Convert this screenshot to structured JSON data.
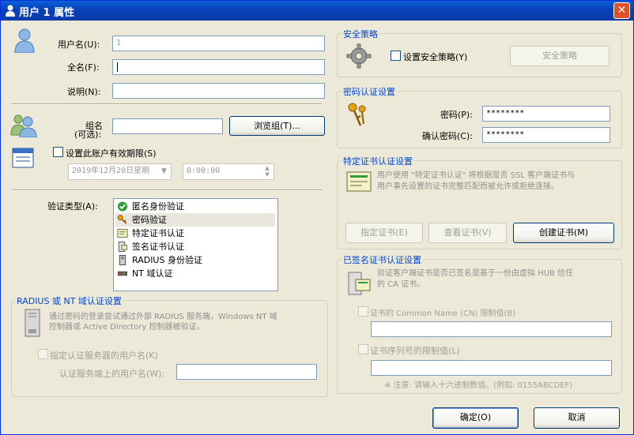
{
  "window": {
    "title": "用户 1 属性",
    "close_label": "✕"
  },
  "user": {
    "username_label": "用户名(U):",
    "username_value": "1",
    "fullname_label": "全名(F):",
    "fullname_value": "",
    "note_label": "说明(N):",
    "note_value": "",
    "group_label": "组名",
    "group_label_sub": "(可选):",
    "group_value": "",
    "browse_group_button": "浏览组(T)...",
    "expire_checkbox_label": "设置此账户有效期限(S)",
    "expire_date_value": "2019年12月20日星期",
    "expire_time_value": "0:00:00"
  },
  "auth": {
    "type_label": "验证类型(A):",
    "items": [
      {
        "label": "匿名身份验证",
        "icon": "check-green-icon"
      },
      {
        "label": "密码验证",
        "icon": "key-icon",
        "selected": true
      },
      {
        "label": "特定证书认证",
        "icon": "certificate-icon"
      },
      {
        "label": "签名证书认证",
        "icon": "signed-cert-icon"
      },
      {
        "label": "RADIUS 身份验证",
        "icon": "server-icon"
      },
      {
        "label": "NT 域认证",
        "icon": "nt-domain-icon"
      }
    ]
  },
  "radius": {
    "group_title": "RADIUS 或 NT 域认证设置",
    "desc_line1": "通过密码的登录尝试通过外部 RADIUS 服务端，Windows NT 域",
    "desc_line2": "控制器或 Active Directory 控制器被验证。",
    "specify_checkbox_label": "指定认证服务器的用户名(K)",
    "server_username_label": "认证服务端上的用户名(W):",
    "server_username_value": ""
  },
  "security": {
    "group_title": "安全策略",
    "checkbox_label": "设置安全策略(Y)",
    "button_label": "安全策略"
  },
  "password": {
    "group_title": "密码认证设置",
    "password_label": "密码(P):",
    "password_value": "********",
    "confirm_label": "确认密码(C):",
    "confirm_value": "********"
  },
  "cert": {
    "group_title": "特定证书认证设置",
    "desc_line1": "用户使用 \"特定证书认证\" 将根据是否 SSL 客户端证书与",
    "desc_line2": "用户事先设置的证书完整匹配而被允许或拒绝连接。",
    "specify_button": "指定证书(E)",
    "view_button": "查看证书(V)",
    "create_button": "创建证书(M)"
  },
  "signed": {
    "group_title": "已签名证书认证设置",
    "desc_line1": "验证客户端证书是否已签名是基于一份由虚拟 HUB 信任",
    "desc_line2": "的 CA 证书。",
    "cn_checkbox_label": "证书的 Common Name (CN) 限制值(B)",
    "cn_value": "",
    "serial_checkbox_label": "证书序列号的限制值(L)",
    "serial_value": "",
    "note": "※ 注意: 请输入十六进制数值。(例如: 0155ABCDEF)"
  },
  "footer": {
    "ok_label": "确定(O)",
    "cancel_label": "取消"
  }
}
